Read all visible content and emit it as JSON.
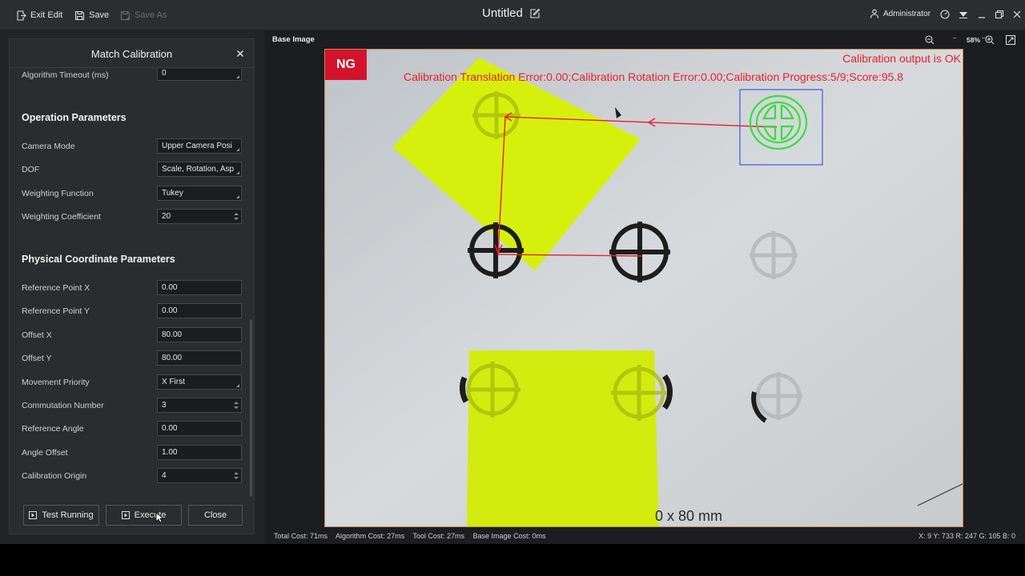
{
  "toolbar": {
    "exit_edit": "Exit Edit",
    "save": "Save",
    "save_as": "Save As",
    "title": "Untitled",
    "user": "Administrator"
  },
  "panel": {
    "title": "Match Calibration",
    "partial_label": "Algorithm Timeout (ms)",
    "partial_value": "0",
    "operation_title": "Operation Parameters",
    "operation": [
      {
        "label": "Camera Mode",
        "value": "Upper Camera Posi"
      },
      {
        "label": "DOF",
        "value": "Scale, Rotation, Asp"
      },
      {
        "label": "Weighting Function",
        "value": "Tukey"
      },
      {
        "label": "Weighting Coefficient",
        "value": "20"
      }
    ],
    "physical_title": "Physical Coordinate Parameters",
    "physical": [
      {
        "label": "Reference Point X",
        "value": "0.00"
      },
      {
        "label": "Reference Point Y",
        "value": "0.00"
      },
      {
        "label": "Offset X",
        "value": "80.00"
      },
      {
        "label": "Offset Y",
        "value": "80.00"
      },
      {
        "label": "Movement Priority",
        "value": "X First"
      },
      {
        "label": "Commutation Number",
        "value": "3"
      },
      {
        "label": "Reference Angle",
        "value": "0.00"
      },
      {
        "label": "Angle Offset",
        "value": "1.00"
      },
      {
        "label": "Calibration Origin",
        "value": "4"
      }
    ],
    "buttons": {
      "test": "Test Running",
      "execute": "Execute",
      "close": "Close"
    }
  },
  "view": {
    "title": "Base Image",
    "zoom": "58%",
    "ng_badge": "NG",
    "overlay_line1": "Calibration output is OK",
    "overlay_line2": "Calibration Translation Error:0.00;Calibration Rotation Error:0.00;Calibration Progress:5/9;Score:95.8",
    "board_text": "0 x 80 mm",
    "status": {
      "total": "Total Cost: 71ms",
      "algorithm": "Algorithm Cost: 27ms",
      "tool": "Tool Cost: 27ms",
      "base": "Base Image Cost: 0ms"
    },
    "coords": "X: 9 Y: 733   R: 247 G: 105 B: 0",
    "colors": {
      "ng": "#d3132c",
      "overlay_text": "#e8202a",
      "match_contour": "#35e03a",
      "roi_box": "#3d5bdc",
      "sticky_note": "#d6f00e"
    }
  }
}
